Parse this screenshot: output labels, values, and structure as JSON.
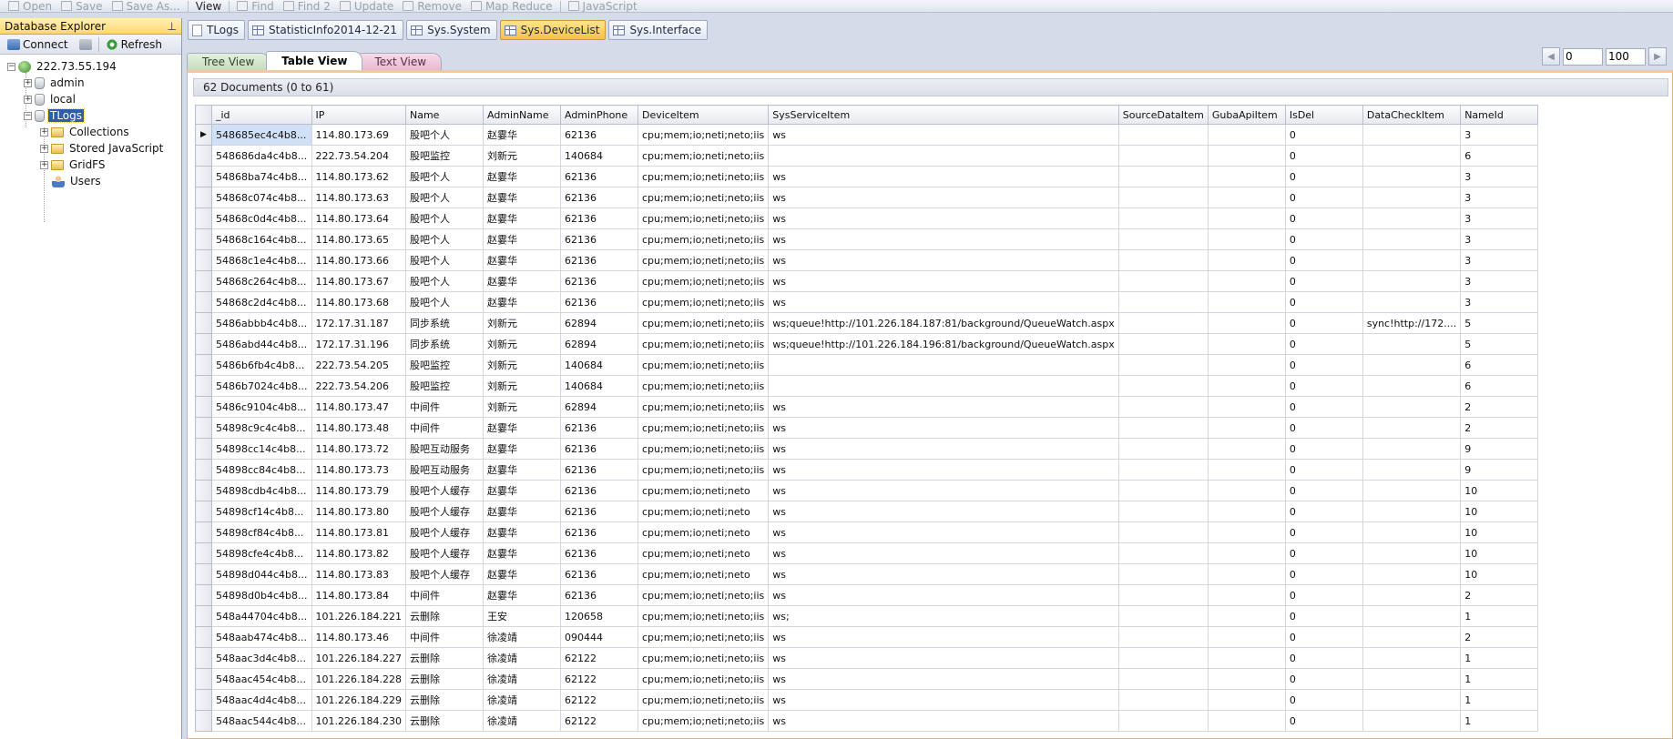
{
  "toolbar": {
    "items": [
      {
        "label": "Open",
        "icon": "open-icon",
        "enabled": false
      },
      {
        "label": "Save",
        "icon": "save-icon",
        "enabled": false
      },
      {
        "label": "Save As...",
        "icon": "save-as-icon",
        "enabled": false
      },
      {
        "label": "View",
        "icon": "",
        "enabled": true
      },
      {
        "label": "Find",
        "icon": "find-icon",
        "enabled": false
      },
      {
        "label": "Find 2",
        "icon": "find-icon",
        "enabled": false
      },
      {
        "label": "Update",
        "icon": "update-icon",
        "enabled": false
      },
      {
        "label": "Remove",
        "icon": "remove-icon",
        "enabled": false
      },
      {
        "label": "Map Reduce",
        "icon": "map-reduce-icon",
        "enabled": false
      },
      {
        "label": "JavaScript",
        "icon": "javascript-icon",
        "enabled": false
      }
    ]
  },
  "explorer": {
    "title": "Database Explorer",
    "connect_label": "Connect",
    "refresh_label": "Refresh",
    "tree": {
      "server": "222.73.55.194",
      "databases": [
        "admin",
        "local",
        "TLogs"
      ],
      "selected_db": "TLogs",
      "children": [
        "Collections",
        "Stored JavaScript",
        "GridFS",
        "Users"
      ]
    }
  },
  "doc_tabs": [
    {
      "label": "TLogs",
      "icon": "document-icon",
      "active": false
    },
    {
      "label": "StatisticInfo2014-12-21",
      "icon": "grid-icon",
      "active": false
    },
    {
      "label": "Sys.System",
      "icon": "grid-icon",
      "active": false
    },
    {
      "label": "Sys.DeviceList",
      "icon": "grid-icon",
      "active": true
    },
    {
      "label": "Sys.Interface",
      "icon": "grid-icon",
      "active": false
    }
  ],
  "view_tabs": {
    "tree": "Tree View",
    "table": "Table View",
    "text": "Text View",
    "active": "table"
  },
  "pager": {
    "skip": "0",
    "limit": "100"
  },
  "doc_count": "62 Documents (0 to 61)",
  "columns": [
    "_id",
    "IP",
    "Name",
    "AdminName",
    "AdminPhone",
    "DeviceItem",
    "SysServiceItem",
    "SourceDataItem",
    "GubaApiItem",
    "IsDel",
    "DataCheckItem",
    "NameId"
  ],
  "rows": [
    [
      "548685ec4c4b8...",
      "114.80.173.69",
      "股吧个人",
      "赵霎华",
      "62136",
      "cpu;mem;io;neti;neto;iis",
      "ws",
      "",
      "",
      "0",
      "",
      "3"
    ],
    [
      "548686da4c4b8...",
      "222.73.54.204",
      "股吧监控",
      "刘新元",
      "140684",
      "cpu;mem;io;neti;neto;iis",
      "",
      "",
      "",
      "0",
      "",
      "6"
    ],
    [
      "54868ba74c4b8...",
      "114.80.173.62",
      "股吧个人",
      "赵霎华",
      "62136",
      "cpu;mem;io;neti;neto;iis",
      "ws",
      "",
      "",
      "0",
      "",
      "3"
    ],
    [
      "54868c074c4b8...",
      "114.80.173.63",
      "股吧个人",
      "赵霎华",
      "62136",
      "cpu;mem;io;neti;neto;iis",
      "ws",
      "",
      "",
      "0",
      "",
      "3"
    ],
    [
      "54868c0d4c4b8...",
      "114.80.173.64",
      "股吧个人",
      "赵霎华",
      "62136",
      "cpu;mem;io;neti;neto;iis",
      "ws",
      "",
      "",
      "0",
      "",
      "3"
    ],
    [
      "54868c164c4b8...",
      "114.80.173.65",
      "股吧个人",
      "赵霎华",
      "62136",
      "cpu;mem;io;neti;neto;iis",
      "ws",
      "",
      "",
      "0",
      "",
      "3"
    ],
    [
      "54868c1e4c4b8...",
      "114.80.173.66",
      "股吧个人",
      "赵霎华",
      "62136",
      "cpu;mem;io;neti;neto;iis",
      "ws",
      "",
      "",
      "0",
      "",
      "3"
    ],
    [
      "54868c264c4b8...",
      "114.80.173.67",
      "股吧个人",
      "赵霎华",
      "62136",
      "cpu;mem;io;neti;neto;iis",
      "ws",
      "",
      "",
      "0",
      "",
      "3"
    ],
    [
      "54868c2d4c4b8...",
      "114.80.173.68",
      "股吧个人",
      "赵霎华",
      "62136",
      "cpu;mem;io;neti;neto;iis",
      "ws",
      "",
      "",
      "0",
      "",
      "3"
    ],
    [
      "5486abbb4c4b8...",
      "172.17.31.187",
      "同步系统",
      "刘新元",
      "62894",
      "cpu;mem;io;neti;neto;iis",
      "ws;queue!http://101.226.184.187:81/background/QueueWatch.aspx",
      "",
      "",
      "0",
      "sync!http://172....",
      "5"
    ],
    [
      "5486abd44c4b8...",
      "172.17.31.196",
      "同步系统",
      "刘新元",
      "62894",
      "cpu;mem;io;neti;neto;iis",
      "ws;queue!http://101.226.184.196:81/background/QueueWatch.aspx",
      "",
      "",
      "0",
      "",
      "5"
    ],
    [
      "5486b6fb4c4b8...",
      "222.73.54.205",
      "股吧监控",
      "刘新元",
      "140684",
      "cpu;mem;io;neti;neto;iis",
      "",
      "",
      "",
      "0",
      "",
      "6"
    ],
    [
      "5486b7024c4b8...",
      "222.73.54.206",
      "股吧监控",
      "刘新元",
      "140684",
      "cpu;mem;io;neti;neto;iis",
      "",
      "",
      "",
      "0",
      "",
      "6"
    ],
    [
      "5486c9104c4b8...",
      "114.80.173.47",
      "中间件",
      "刘新元",
      "62894",
      "cpu;mem;io;neti;neto;iis",
      "ws",
      "",
      "",
      "0",
      "",
      "2"
    ],
    [
      "54898c9c4c4b8...",
      "114.80.173.48",
      "中间件",
      "赵霎华",
      "62136",
      "cpu;mem;io;neti;neto;iis",
      "ws",
      "",
      "",
      "0",
      "",
      "2"
    ],
    [
      "54898cc14c4b8...",
      "114.80.173.72",
      "股吧互动服务",
      "赵霎华",
      "62136",
      "cpu;mem;io;neti;neto;iis",
      "ws",
      "",
      "",
      "0",
      "",
      "9"
    ],
    [
      "54898cc84c4b8...",
      "114.80.173.73",
      "股吧互动服务",
      "赵霎华",
      "62136",
      "cpu;mem;io;neti;neto;iis",
      "ws",
      "",
      "",
      "0",
      "",
      "9"
    ],
    [
      "54898cdb4c4b8...",
      "114.80.173.79",
      "股吧个人缓存",
      "赵霎华",
      "62136",
      "cpu;mem;io;neti;neto",
      "ws",
      "",
      "",
      "0",
      "",
      "10"
    ],
    [
      "54898cf14c4b8...",
      "114.80.173.80",
      "股吧个人缓存",
      "赵霎华",
      "62136",
      "cpu;mem;io;neti;neto",
      "ws",
      "",
      "",
      "0",
      "",
      "10"
    ],
    [
      "54898cf84c4b8...",
      "114.80.173.81",
      "股吧个人缓存",
      "赵霎华",
      "62136",
      "cpu;mem;io;neti;neto",
      "ws",
      "",
      "",
      "0",
      "",
      "10"
    ],
    [
      "54898cfe4c4b8...",
      "114.80.173.82",
      "股吧个人缓存",
      "赵霎华",
      "62136",
      "cpu;mem;io;neti;neto",
      "ws",
      "",
      "",
      "0",
      "",
      "10"
    ],
    [
      "54898d044c4b8...",
      "114.80.173.83",
      "股吧个人缓存",
      "赵霎华",
      "62136",
      "cpu;mem;io;neti;neto",
      "ws",
      "",
      "",
      "0",
      "",
      "10"
    ],
    [
      "54898d0b4c4b8...",
      "114.80.173.84",
      "中间件",
      "赵霎华",
      "62136",
      "cpu;mem;io;neti;neto;iis",
      "ws",
      "",
      "",
      "0",
      "",
      "2"
    ],
    [
      "548a44704c4b8...",
      "101.226.184.221",
      "云删除",
      "王安",
      "120658",
      "cpu;mem;io;neti;neto;iis",
      "ws;",
      "",
      "",
      "0",
      "",
      "1"
    ],
    [
      "548aab474c4b8...",
      "114.80.173.46",
      "中间件",
      "徐凌靖",
      "090444",
      "cpu;mem;io;neti;neto;iis",
      "ws",
      "",
      "",
      "0",
      "",
      "2"
    ],
    [
      "548aac3d4c4b8...",
      "101.226.184.227",
      "云删除",
      "徐凌靖",
      "62122",
      "cpu;mem;io;neti;neto;iis",
      "ws",
      "",
      "",
      "0",
      "",
      "1"
    ],
    [
      "548aac454c4b8...",
      "101.226.184.228",
      "云删除",
      "徐凌靖",
      "62122",
      "cpu;mem;io;neti;neto;iis",
      "ws",
      "",
      "",
      "0",
      "",
      "1"
    ],
    [
      "548aac4d4c4b8...",
      "101.226.184.229",
      "云删除",
      "徐凌靖",
      "62122",
      "cpu;mem;io;neti;neto;iis",
      "ws",
      "",
      "",
      "0",
      "",
      "1"
    ],
    [
      "548aac544c4b8...",
      "101.226.184.230",
      "云删除",
      "徐凌靖",
      "62122",
      "cpu;mem;io;neti;neto;iis",
      "ws",
      "",
      "",
      "0",
      "",
      "1"
    ]
  ],
  "selected_row": 0
}
